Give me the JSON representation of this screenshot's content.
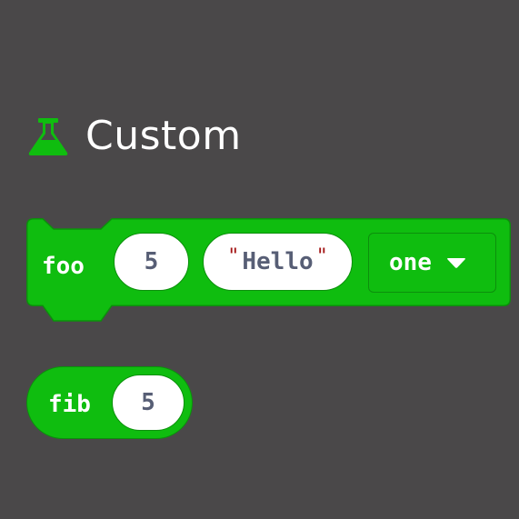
{
  "category": {
    "title": "Custom",
    "icon": "flask-icon",
    "color": "#0fbd0f"
  },
  "blocks": [
    {
      "kind": "statement",
      "label": "foo",
      "number_input": "5",
      "quote_open": "\"",
      "string_input": "Hello",
      "quote_close": "\"",
      "dropdown_value": "one",
      "dropdown_icon": "triangle-down-icon"
    },
    {
      "kind": "reporter",
      "label": "fib",
      "number_input": "5"
    }
  ],
  "colors": {
    "background": "#4a4849",
    "block_fill": "#0fbd0f",
    "block_border": "#0c8f0c",
    "input_text": "#575e75",
    "quote": "#a31515"
  }
}
